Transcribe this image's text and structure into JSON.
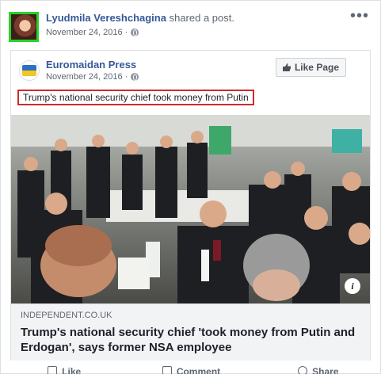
{
  "post": {
    "author": "Lyudmila Vereshchagina",
    "action_text": "shared a post.",
    "date": "November 24, 2016 ·",
    "more_label": "•••"
  },
  "shared_post": {
    "page_name": "Euromaidan Press",
    "date": "November 24, 2016 ·",
    "like_page_label": "Like Page",
    "headline": "Trump's national security chief took money from Putin"
  },
  "link": {
    "domain": "INDEPENDENT.CO.UK",
    "title": "Trump's national security chief 'took money from Putin and Erdogan', says former NSA employee",
    "info_label": "i"
  },
  "actions": {
    "like": "Like",
    "comment": "Comment",
    "share": "Share"
  },
  "colors": {
    "link_blue": "#365899",
    "highlight_red": "#d02a2a",
    "avatar_highlight_green": "#2bd12b"
  }
}
